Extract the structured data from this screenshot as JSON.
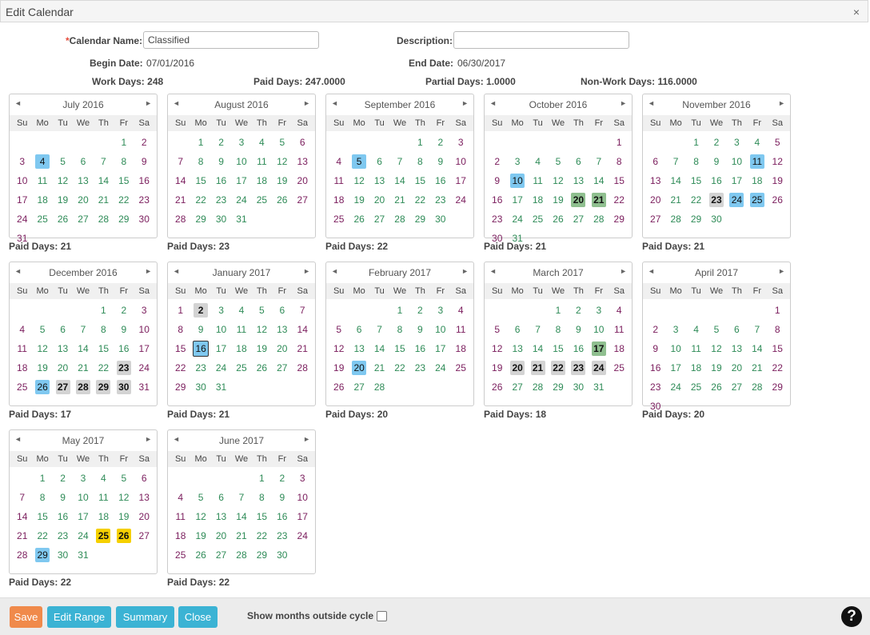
{
  "window": {
    "title": "Edit Calendar",
    "close_icon": "×"
  },
  "form": {
    "calendar_name_required": "*",
    "calendar_name_label": "Calendar Name:",
    "calendar_name_value": "Classified",
    "description_label": "Description:",
    "description_value": "",
    "begin_date_label": "Begin Date:",
    "begin_date_value": "07/01/2016",
    "end_date_label": "End Date:",
    "end_date_value": "06/30/2017",
    "work_days_label": "Work Days:",
    "work_days_value": "248",
    "paid_days_label": "Paid Days:",
    "paid_days_value": "247.0000",
    "partial_days_label": "Partial Days:",
    "partial_days_value": "1.0000",
    "non_work_days_label": "Non-Work Days:",
    "non_work_days_value": "116.0000"
  },
  "dow": [
    "Su",
    "Mo",
    "Tu",
    "We",
    "Th",
    "Fr",
    "Sa"
  ],
  "nav": {
    "prev": "◄",
    "next": "►"
  },
  "months": [
    {
      "name": "July 2016",
      "days": 31,
      "start": 5,
      "paid": "Paid Days: 21",
      "hl": {
        "4": "blue"
      }
    },
    {
      "name": "August 2016",
      "days": 31,
      "start": 1,
      "paid": "Paid Days: 23",
      "hl": {}
    },
    {
      "name": "September 2016",
      "days": 30,
      "start": 4,
      "paid": "Paid Days: 22",
      "hl": {
        "5": "blue"
      }
    },
    {
      "name": "October 2016",
      "days": 31,
      "start": 6,
      "paid": "Paid Days: 21",
      "hl": {
        "10": "blue",
        "20": "green",
        "21": "green"
      }
    },
    {
      "name": "November 2016",
      "days": 30,
      "start": 2,
      "paid": "Paid Days: 21",
      "hl": {
        "11": "blue",
        "23": "grey",
        "24": "blue",
        "25": "blue"
      }
    },
    {
      "name": "December 2016",
      "days": 31,
      "start": 4,
      "paid": "Paid Days: 17",
      "hl": {
        "23": "grey",
        "26": "blue",
        "27": "grey",
        "28": "grey",
        "29": "grey",
        "30": "grey"
      }
    },
    {
      "name": "January 2017",
      "days": 31,
      "start": 0,
      "paid": "Paid Days: 21",
      "hl": {
        "2": "grey",
        "16": "blue-today"
      }
    },
    {
      "name": "February 2017",
      "days": 28,
      "start": 3,
      "paid": "Paid Days: 20",
      "hl": {
        "20": "blue"
      }
    },
    {
      "name": "March 2017",
      "days": 31,
      "start": 3,
      "paid": "Paid Days: 18",
      "hl": {
        "17": "green",
        "20": "grey",
        "21": "grey",
        "22": "grey",
        "23": "grey",
        "24": "grey"
      }
    },
    {
      "name": "April 2017",
      "days": 30,
      "start": 6,
      "paid": "Paid Days: 20",
      "hl": {}
    },
    {
      "name": "May 2017",
      "days": 31,
      "start": 1,
      "paid": "Paid Days: 22",
      "hl": {
        "25": "yellow",
        "26": "yellow",
        "29": "blue"
      }
    },
    {
      "name": "June 2017",
      "days": 30,
      "start": 4,
      "paid": "Paid Days: 22",
      "hl": {}
    }
  ],
  "footer": {
    "save": "Save",
    "edit_range": "Edit Range",
    "summary": "Summary",
    "close": "Close",
    "show_months_label": "Show months outside cycle",
    "show_months_checked": false,
    "help_icon": "?"
  },
  "colors": {
    "save": "#f08a4b",
    "buttons": "#3bb3d4",
    "workday": "#2e8b57",
    "weekend": "#7a1c5c",
    "selected": "#7fc8f0",
    "holiday": "#d3d3d3",
    "partial": "#8fbf8f",
    "special": "#f5d000"
  }
}
